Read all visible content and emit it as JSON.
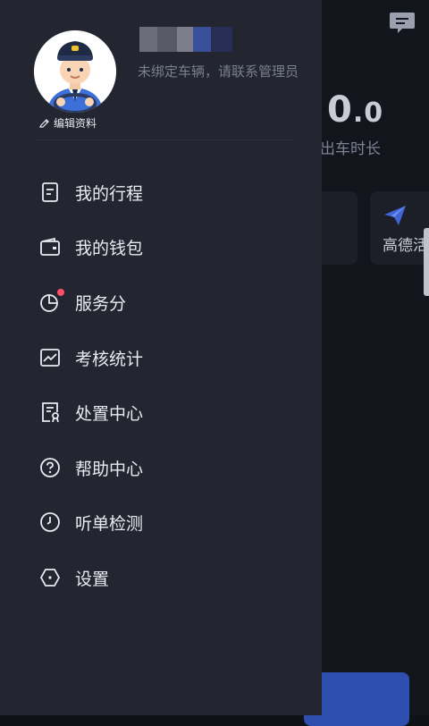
{
  "background": {
    "stat_value_int": "0",
    "stat_value_dec": ".0",
    "stat_label": "出车时长",
    "card_label": "高德活"
  },
  "profile": {
    "hint": "未绑定车辆，请联系管理员",
    "edit_label": "编辑资料"
  },
  "menu": {
    "items": [
      {
        "label": "我的行程",
        "icon": "document-icon"
      },
      {
        "label": "我的钱包",
        "icon": "wallet-icon"
      },
      {
        "label": "服务分",
        "icon": "pie-chart-icon",
        "badge": true
      },
      {
        "label": "考核统计",
        "icon": "trend-chart-icon"
      },
      {
        "label": "处置中心",
        "icon": "certificate-icon"
      },
      {
        "label": "帮助中心",
        "icon": "help-icon"
      },
      {
        "label": "听单检测",
        "icon": "timer-icon"
      },
      {
        "label": "设置",
        "icon": "settings-icon"
      }
    ]
  },
  "colors": {
    "drawer_bg": "#232631",
    "accent": "#2e4fb0",
    "badge": "#ff4d6a"
  }
}
